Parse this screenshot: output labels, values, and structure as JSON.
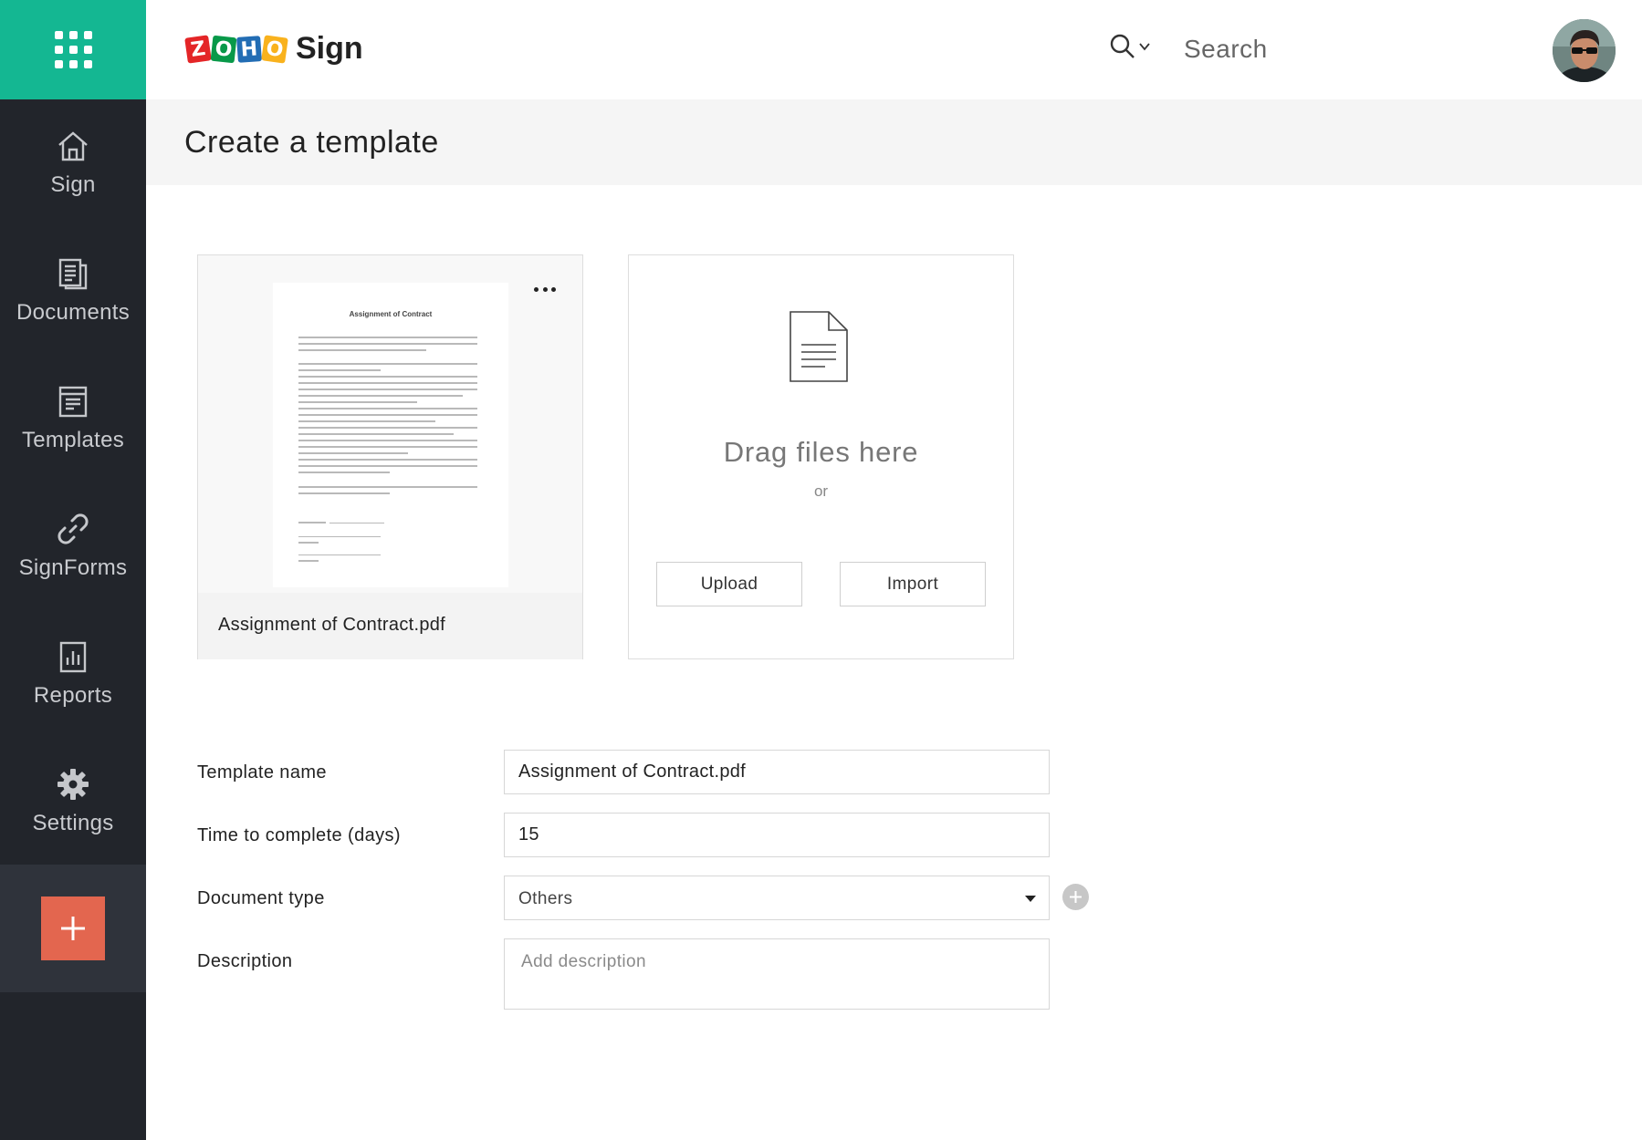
{
  "sidebar": {
    "apps_icon": "apps-grid-icon",
    "items": [
      {
        "label": "Sign",
        "icon": "home-icon"
      },
      {
        "label": "Documents",
        "icon": "documents-icon"
      },
      {
        "label": "Templates",
        "icon": "templates-icon"
      },
      {
        "label": "SignForms",
        "icon": "link-icon"
      },
      {
        "label": "Reports",
        "icon": "reports-icon"
      },
      {
        "label": "Settings",
        "icon": "gear-icon"
      }
    ],
    "create_icon": "plus-icon"
  },
  "header": {
    "logo_letters": [
      "Z",
      "O",
      "H",
      "O"
    ],
    "logo_word": "Sign",
    "search_placeholder": "Search"
  },
  "page": {
    "title": "Create a template"
  },
  "document_card": {
    "preview_title": "Assignment of Contract",
    "file_name": "Assignment of Contract.pdf"
  },
  "drop_zone": {
    "title": "Drag files here",
    "or_text": "or",
    "upload_label": "Upload",
    "import_label": "Import"
  },
  "form": {
    "template_name_label": "Template name",
    "template_name_value": "Assignment of Contract.pdf",
    "time_label": "Time to complete (days)",
    "time_value": "15",
    "doc_type_label": "Document type",
    "doc_type_value": "Others",
    "description_label": "Description",
    "description_placeholder": "Add description"
  },
  "colors": {
    "brand_green": "#14b792",
    "sidebar_bg": "#22252b",
    "create_button": "#e3664f"
  }
}
